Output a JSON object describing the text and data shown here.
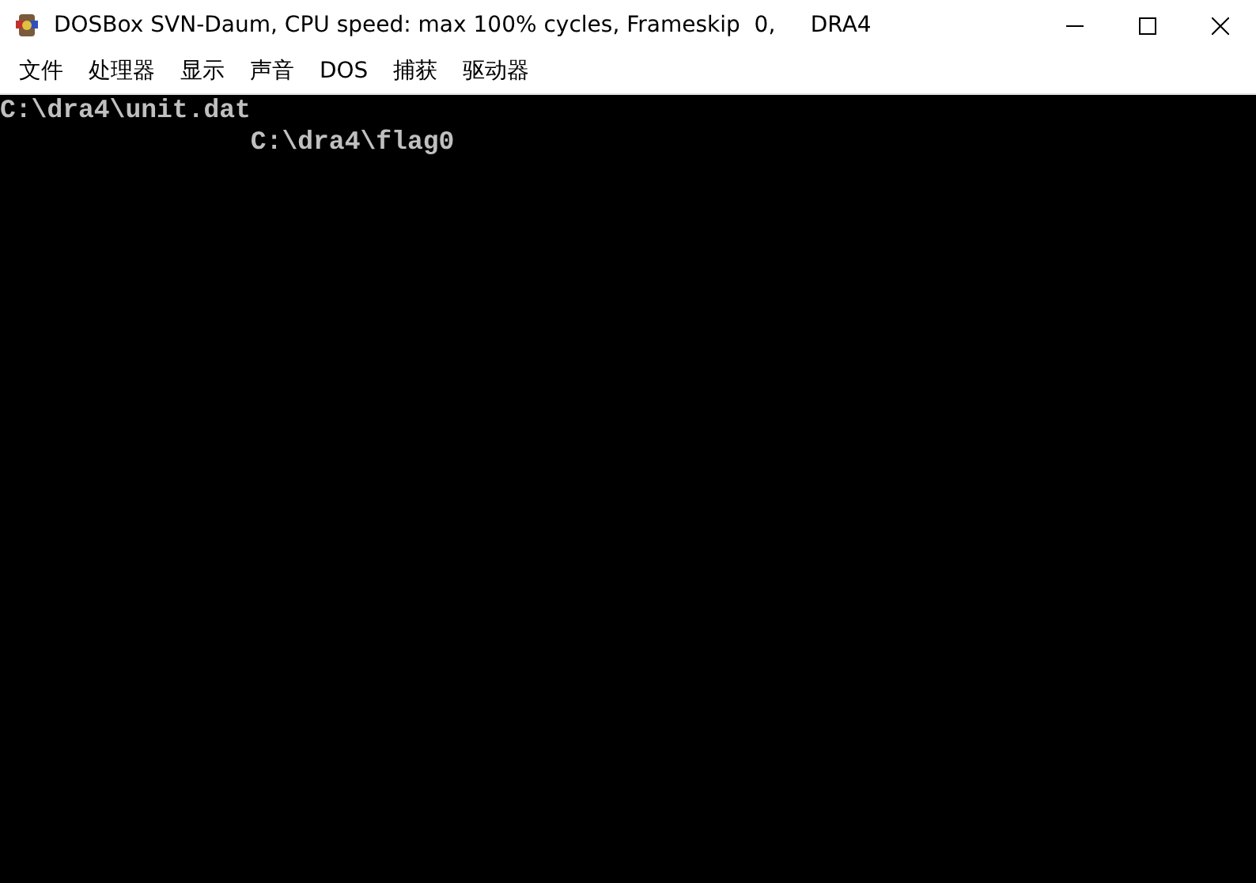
{
  "window": {
    "title": "DOSBox SVN-Daum, CPU speed: max 100% cycles, Frameskip  0,     DRA4"
  },
  "menu": [
    "文件",
    "处理器",
    "显示",
    "声音",
    "DOS",
    "捕获",
    "驱动器"
  ],
  "console": {
    "lines": [
      "C:\\dra4\\unit.dat",
      "                C:\\dra4\\flag0"
    ]
  }
}
